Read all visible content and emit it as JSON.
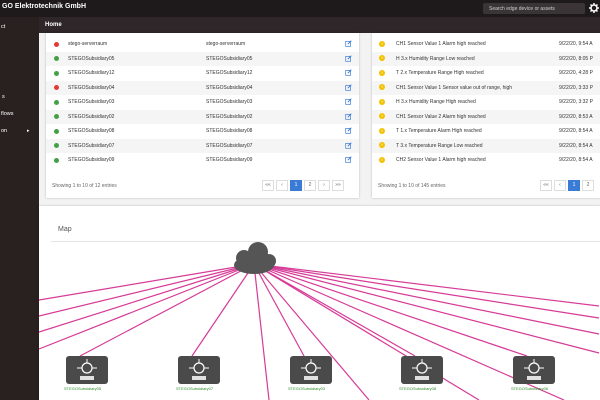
{
  "header": {
    "title": "GO Elektrotechnik GmbH",
    "search_placeholder": "Search edge device or assets"
  },
  "sidebar": {
    "items": [
      "ct",
      "s",
      "flows",
      "on"
    ]
  },
  "subheader": {
    "home": "Home"
  },
  "devices": {
    "rows": [
      {
        "name": "stego-serverraum",
        "alias": "stego-serverraum",
        "status": "red"
      },
      {
        "name": "STEGOSubsidiary05",
        "alias": "STEGOSubsidiary05",
        "status": "green"
      },
      {
        "name": "STEGOSubsidiary12",
        "alias": "STEGOSubsidiary12",
        "status": "green"
      },
      {
        "name": "STEGOSubsidiary04",
        "alias": "STEGOSubsidiary04",
        "status": "red"
      },
      {
        "name": "STEGOSubsidiary03",
        "alias": "STEGOSubsidiary03",
        "status": "green"
      },
      {
        "name": "STEGOSubsidiary02",
        "alias": "STEGOSubsidiary02",
        "status": "green"
      },
      {
        "name": "STEGOSubsidiary08",
        "alias": "STEGOSubsidiary08",
        "status": "green"
      },
      {
        "name": "STEGOSubsidiary07",
        "alias": "STEGOSubsidiary07",
        "status": "green"
      },
      {
        "name": "STEGOSubsidiary09",
        "alias": "STEGOSubsidiary09",
        "status": "green"
      }
    ],
    "footer": "Showing 1 to 10 of 12 entries",
    "pages": [
      "««",
      "‹",
      "1",
      "2",
      "›",
      "»»"
    ]
  },
  "alarms": {
    "rows": [
      {
        "message": "CH1 Sensor Value 1 Alarm high reached",
        "time": "9/22/20, 9:54 A"
      },
      {
        "message": "H 3.x Humidity Range Low reached",
        "time": "9/22/20, 8:05 P"
      },
      {
        "message": "T 2.x Temperature Range High reached",
        "time": "9/22/20, 4:28 P"
      },
      {
        "message": "CH1 Sensor Value 1 Sensor value out of range, high",
        "time": "9/22/20, 3:33 P"
      },
      {
        "message": "H 3.x Humidity Range High reached",
        "time": "9/22/20, 3:32 P"
      },
      {
        "message": "CH1 Sensor Value 2 Alarm high reached",
        "time": "9/22/20, 8:53 A"
      },
      {
        "message": "T 1.x Temperature Alarm High reached",
        "time": "9/22/20, 8:54 A"
      },
      {
        "message": "T 3.x Temperature Range Low reached",
        "time": "9/22/20, 8:54 A"
      },
      {
        "message": "CH2 Sensor Value 1 Alarm high reached",
        "time": "9/22/20, 8:54 A"
      }
    ],
    "footer": "Showing 1 to 10 of 145 entries",
    "pages": [
      "««",
      "‹",
      "1",
      "2"
    ]
  },
  "map": {
    "title": "Map",
    "nodes": [
      "STEGOSubsidiary05",
      "STEGOSubsidiary07",
      "STEGOSubsidiary03",
      "STEGOSubsidiary08",
      "STEGOSubsidiary06"
    ]
  },
  "colors": {
    "status_red": "#e53935",
    "status_green": "#43a047",
    "link_line": "#d63b97",
    "accent": "#3a7bd5"
  }
}
